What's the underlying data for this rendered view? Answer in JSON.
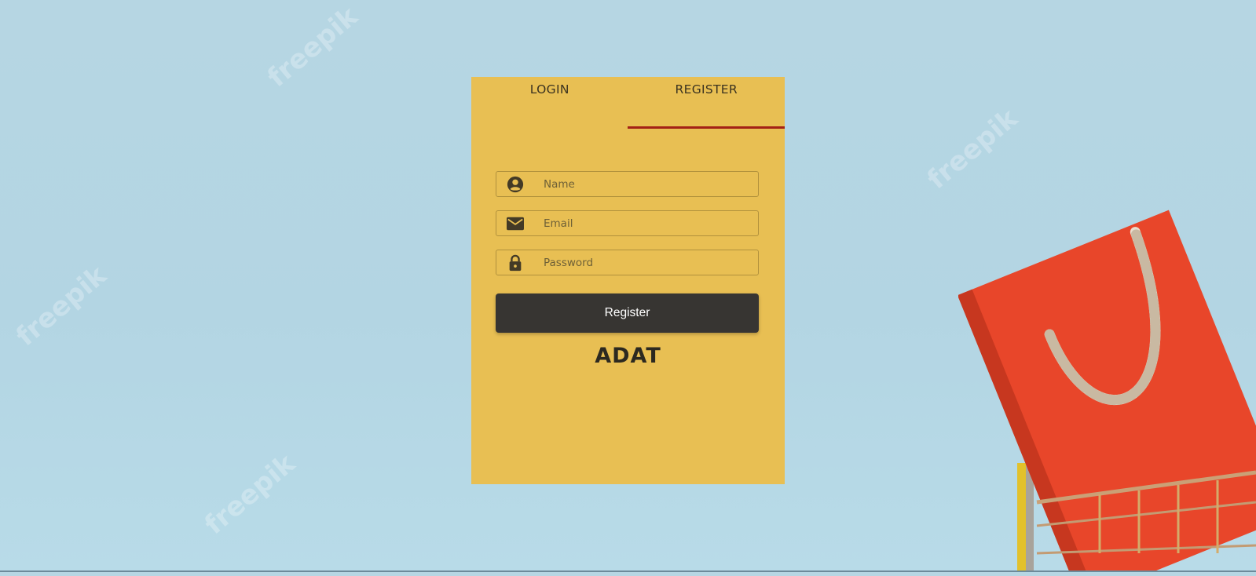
{
  "tabs": [
    {
      "label": "LOGIN",
      "active": false
    },
    {
      "label": "REGISTER",
      "active": true
    }
  ],
  "form": {
    "name": {
      "value": "",
      "placeholder": "Name",
      "icon": "account-circle-icon"
    },
    "email": {
      "value": "",
      "placeholder": "Email",
      "icon": "envelope-icon"
    },
    "password": {
      "value": "",
      "placeholder": "Password",
      "icon": "lock-icon"
    },
    "submit_label": "Register"
  },
  "brand": "ADAT",
  "watermark_text": "freepik",
  "colors": {
    "card": "#e8bf53",
    "tab_indicator": "#a32015",
    "button": "#373532",
    "background": "#b4d5e3",
    "bag": "#e8462a"
  }
}
